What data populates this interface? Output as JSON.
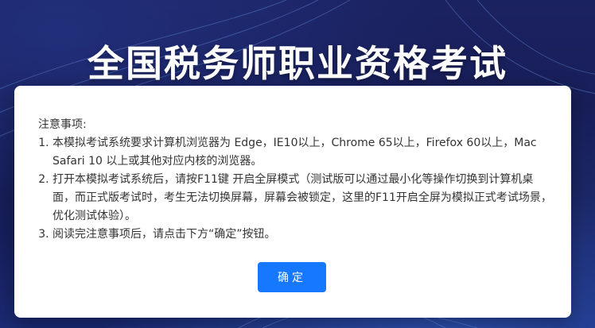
{
  "header": {
    "title": "全国税务师职业资格考试"
  },
  "notice": {
    "heading": "注意事项:",
    "items": [
      "本模拟考试系统要求计算机浏览器为 Edge，IE10以上，Chrome 65以上，Firefox 60以上，Mac Safari 10 以上或其他对应内核的浏览器。",
      "打开本模拟考试系统后，请按F11键 开启全屏模式（测试版可以通过最小化等操作切换到计算机桌面，而正式版考试时，考生无法切换屏幕，屏幕会被锁定，这里的F11开启全屏为模拟正式考试场景，优化测试体验）。",
      "阅读完注意事项后，请点击下方“确定”按钮。"
    ]
  },
  "actions": {
    "confirm_label": "确定"
  },
  "colors": {
    "background": "#141a4e",
    "primary": "#1677ff",
    "dialog": "#ffffff"
  }
}
